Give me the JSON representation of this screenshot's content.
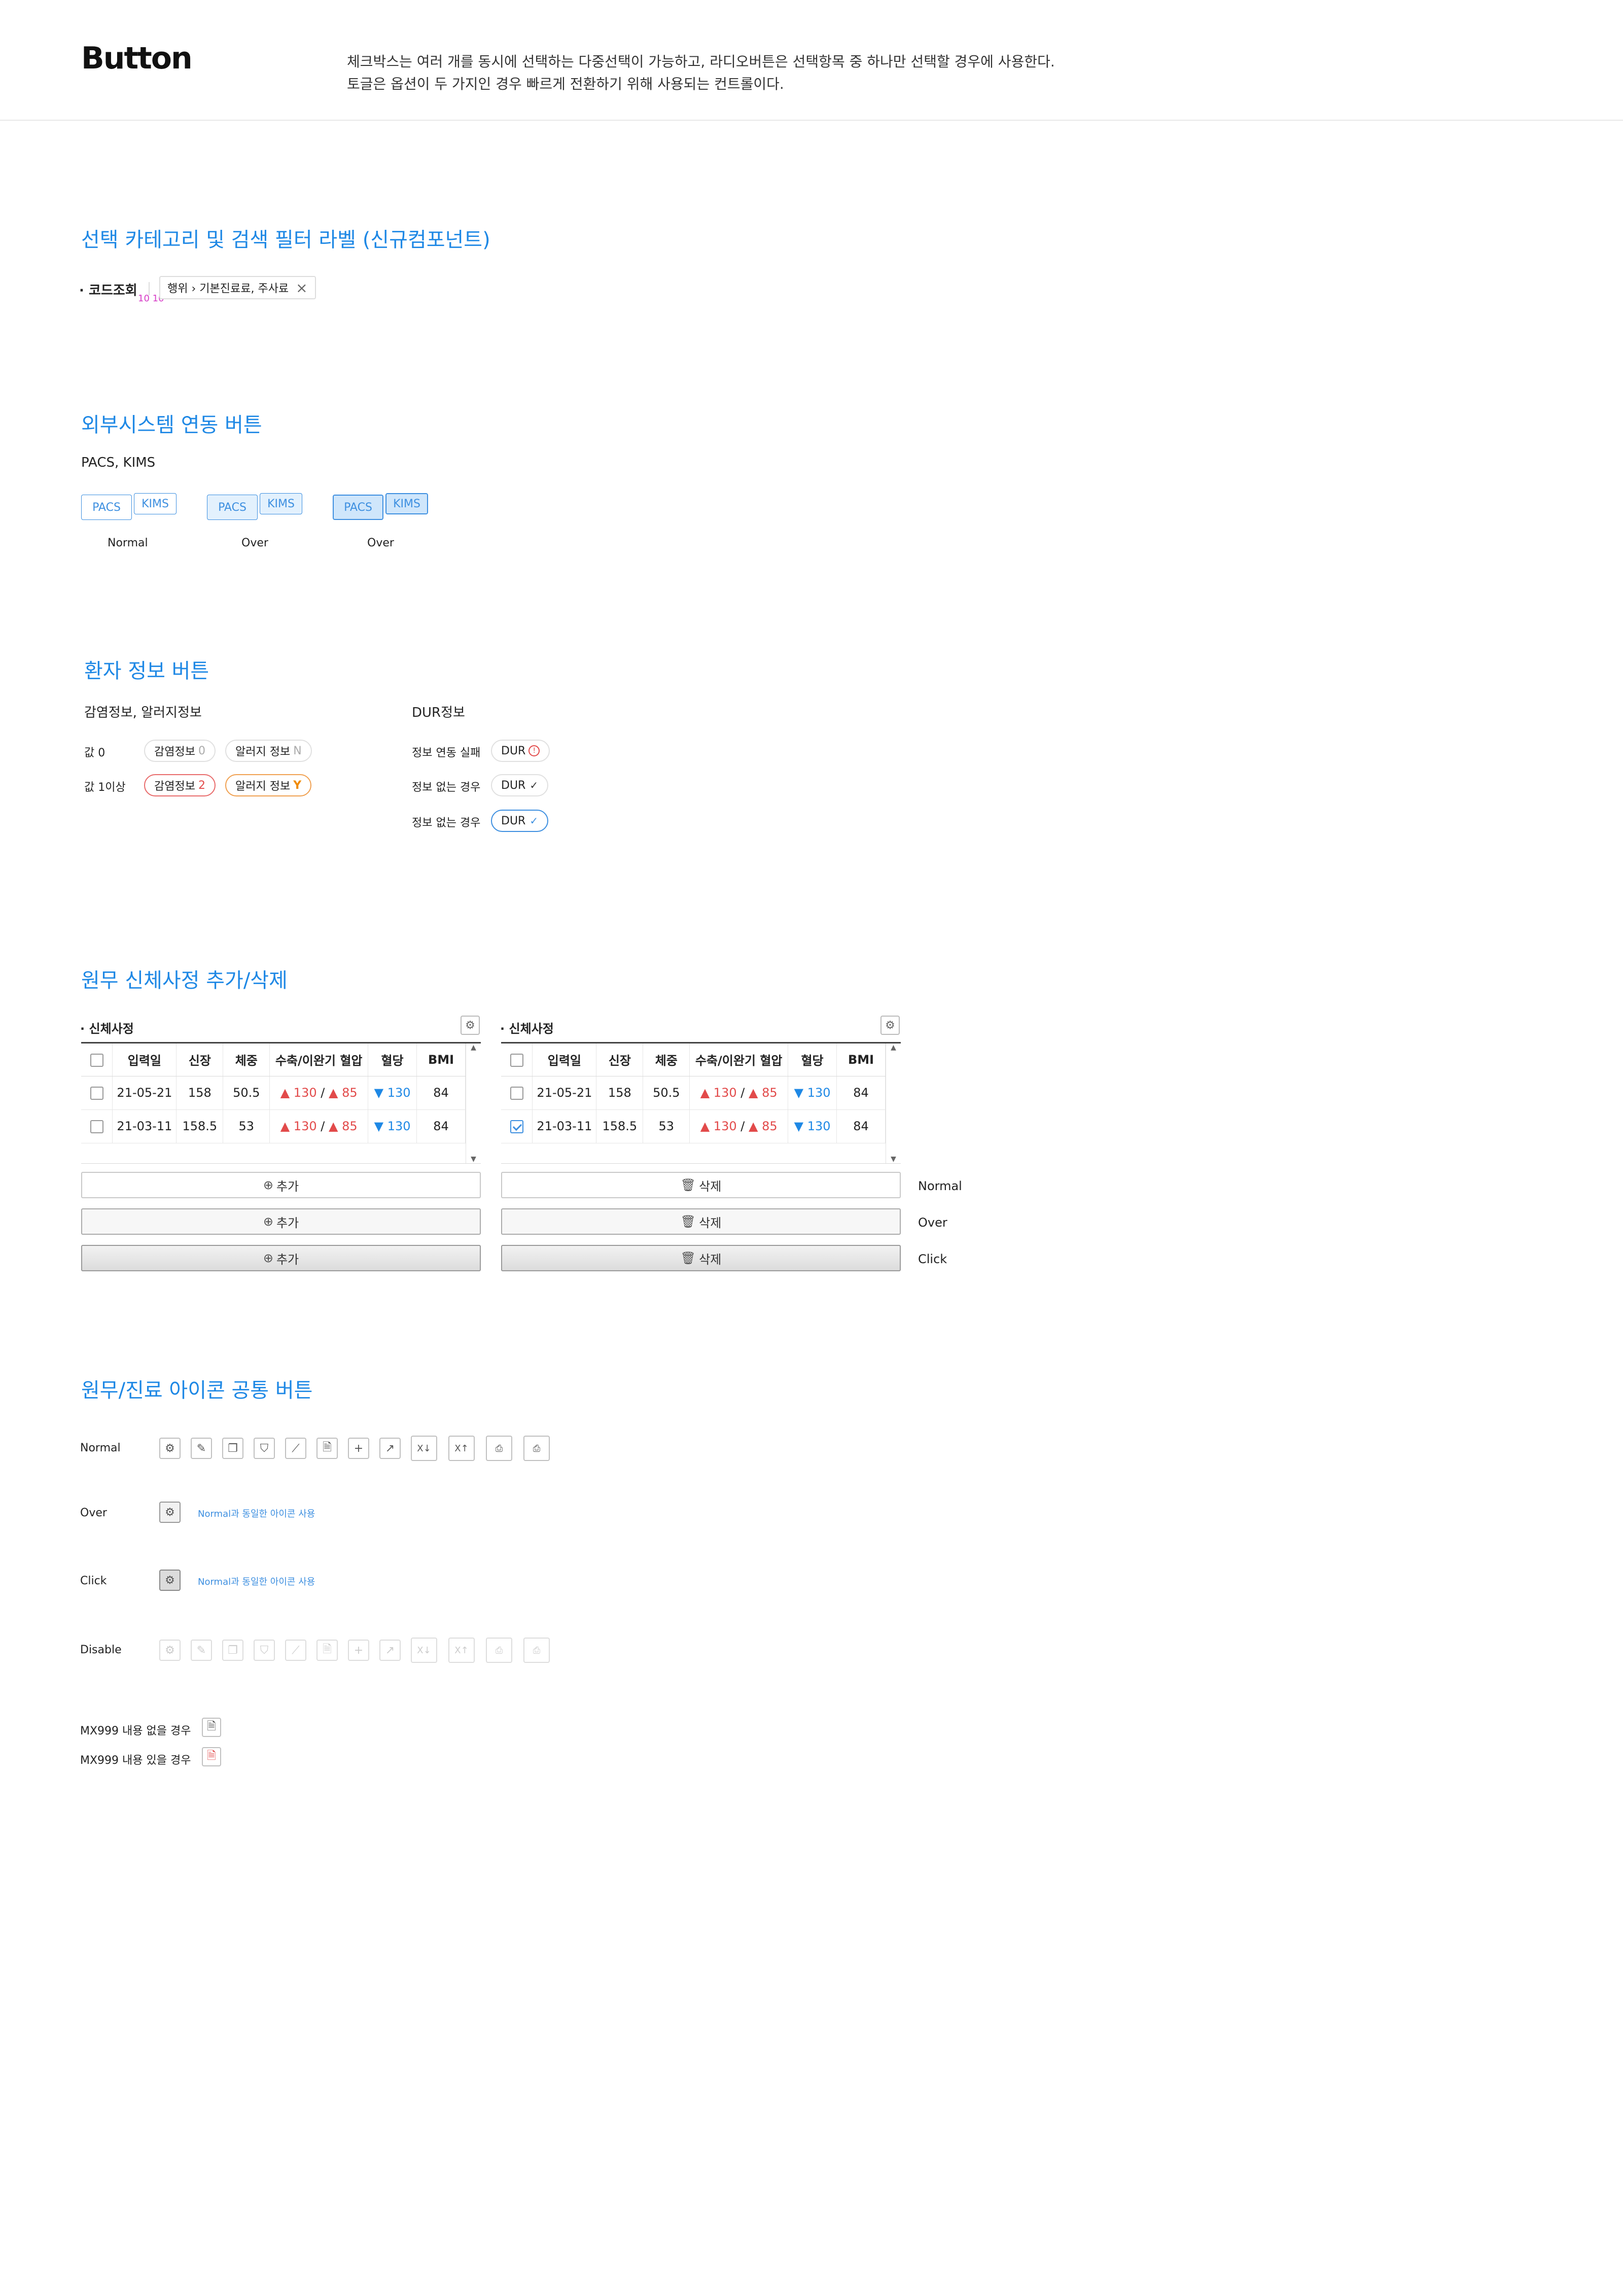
{
  "header": {
    "title": "Button",
    "desc_line1": "체크박스는 여러 개를 동시에 선택하는 다중선택이 가능하고, 라디오버튼은 선택항목 중 하나만 선택할 경우에 사용한다.",
    "desc_line2": "토글은 옵션이 두 가지인 경우 빠르게 전환하기 위해 사용되는 컨트롤이다."
  },
  "sec1": {
    "title": "선택 카테고리 및 검색 필터 라벨 (신규컴포넌트)",
    "bullet_label": "코드조회",
    "spacing_note": "10 10",
    "filter_text": "행위 › 기본진료료, 주사료",
    "close": "×"
  },
  "sec2": {
    "title": "외부시스템 연동 버튼",
    "subtitle": "PACS, KIMS",
    "pacs": "PACS",
    "kims": "KIMS",
    "states": [
      "Normal",
      "Over",
      "Over"
    ]
  },
  "sec3": {
    "title": "환자 정보 버튼",
    "left_sub": "감염정보, 알러지정보",
    "right_sub": "DUR정보",
    "row0_label": "값 0",
    "row1_label": "값 1이상",
    "infection": "감염정보",
    "allergy": "알러지 정보",
    "inf0": "0",
    "all0": "N",
    "inf1": "2",
    "all1": "Y",
    "dur_rows": [
      {
        "label": "정보 연동 실패",
        "btn": "DUR",
        "mark": "!"
      },
      {
        "label": "정보 없는 경우",
        "btn": "DUR",
        "mark": "✓"
      },
      {
        "label": "정보 없는 경우",
        "btn": "DUR",
        "mark": "✓"
      }
    ]
  },
  "sec4": {
    "title": "원무 신체사정 추가/삭제",
    "panel_title": "신체사정",
    "columns": [
      "입력일",
      "신장",
      "체중",
      "수축/이완기 혈압",
      "혈당",
      "BMI"
    ],
    "rows": [
      {
        "date": "21-05-21",
        "height": "158",
        "weight": "50.5",
        "sys": "130",
        "dia": "85",
        "sugar": "130",
        "bmi": "84"
      },
      {
        "date": "21-03-11",
        "height": "158.5",
        "weight": "53",
        "sys": "130",
        "dia": "85",
        "sugar": "130",
        "bmi": "84"
      }
    ],
    "sep": "/",
    "add": "추가",
    "delete": "삭제",
    "states": [
      "Normal",
      "Over",
      "Click"
    ]
  },
  "sec5": {
    "title": "원무/진료 아이콘 공통 버튼",
    "normal": "Normal",
    "over": "Over",
    "click": "Click",
    "disable": "Disable",
    "same_note": "Normal과 동일한 아이콘 사용",
    "mx_empty": "MX999 내용 없을 경우",
    "mx_filled": "MX999 내용 있을 경우",
    "icons": [
      "gear-icon",
      "edit-icon",
      "copy-icon",
      "filter-icon",
      "chart-icon",
      "document-icon",
      "plus-icon",
      "external-link-icon",
      "excel-download-icon",
      "excel-upload-icon",
      "print-setting-icon",
      "print-icon"
    ]
  }
}
